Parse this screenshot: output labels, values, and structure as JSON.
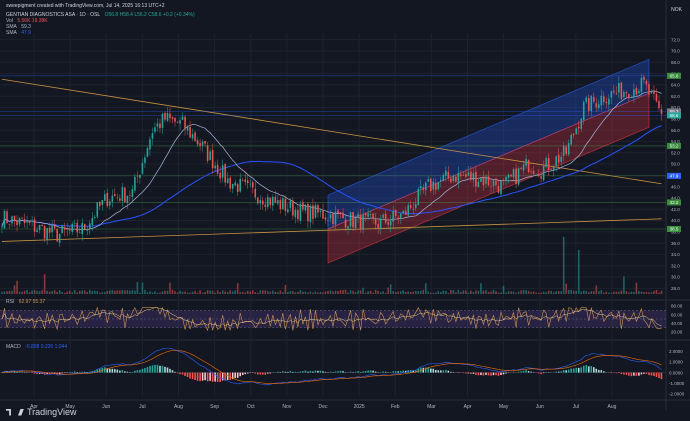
{
  "header": {
    "credit": "sweepigment created with TradingView.com, Jul 14, 2025 16:13 UTC+2",
    "symbol_line": "GENTIAN DIAGNOSTICS ASA · 1D · OSL",
    "ohlc": "O56.8 H58.4 L56.2 C58.6 +0.2 (+0.34%)",
    "vol_label": "Vol",
    "vol_values": "5.56K  19.38K",
    "sma1_label": "SMA",
    "sma1_value": "59.3",
    "sma2_label": "SMA",
    "sma2_value": "47.9",
    "currency": "NOK",
    "rsi_label": "RSI",
    "rsi_values": "62.97  55.37",
    "macd_label": "MACD",
    "macd_values": "-0.808  0.226  1.044",
    "brand": "TradingView"
  },
  "colors": {
    "background": "#131722",
    "up": "#26a69a",
    "down": "#ef5350",
    "channel_upper": "#2962ff",
    "channel_lower": "#f23645",
    "sma_fast": "#a9b7d8",
    "sma_slow": "#2952ff",
    "trendline": "#c8923f",
    "rsi_line": "#ce9455",
    "rsi_band": "#7e57c2",
    "support_line": "#4caf50"
  },
  "chart_data": {
    "type": "candlestick",
    "x_ticks": [
      "Apr",
      "May",
      "Jun",
      "Jul",
      "Aug",
      "Sep",
      "Oct",
      "Nov",
      "Dec",
      "2025",
      "Feb",
      "Mar",
      "Apr",
      "May",
      "Jun",
      "Jul",
      "Aug"
    ],
    "y_ticks": [
      28.0,
      30.0,
      32.0,
      34.0,
      36.0,
      38.0,
      40.0,
      42.0,
      44.0,
      46.0,
      48.0,
      50.0,
      52.0,
      54.0,
      56.0,
      58.0,
      60.0,
      62.0,
      64.0,
      66.0,
      68.0,
      70.0,
      72.0
    ],
    "ylim": [
      27,
      73
    ],
    "price_path": [
      [
        0,
        40.5
      ],
      [
        12,
        39
      ],
      [
        22,
        37.5
      ],
      [
        32,
        38.5
      ],
      [
        42,
        44
      ],
      [
        52,
        45
      ],
      [
        60,
        56
      ],
      [
        65,
        58
      ],
      [
        72,
        57
      ],
      [
        80,
        53
      ],
      [
        90,
        47
      ],
      [
        100,
        45
      ],
      [
        110,
        43
      ],
      [
        120,
        41.5
      ],
      [
        130,
        41
      ],
      [
        140,
        40
      ],
      [
        150,
        39.5
      ],
      [
        160,
        41
      ],
      [
        170,
        46
      ],
      [
        180,
        48
      ],
      [
        190,
        47.5
      ],
      [
        200,
        46
      ],
      [
        210,
        50
      ],
      [
        215,
        49
      ],
      [
        225,
        52
      ],
      [
        232,
        60
      ],
      [
        240,
        62
      ],
      [
        248,
        63
      ],
      [
        256,
        64
      ],
      [
        263,
        58.6
      ]
    ],
    "highlighted_levels": [
      {
        "value": 65.6,
        "label": "65.6"
      },
      {
        "value": 59.3,
        "label": "59.3"
      },
      {
        "value": 58.6,
        "label": "58.6"
      },
      {
        "value": 53.2,
        "label": "53.2"
      },
      {
        "value": 47.9,
        "label": "47.9"
      },
      {
        "value": 43.2,
        "label": "43.2"
      },
      {
        "value": 38.5,
        "label": "38.5"
      }
    ],
    "channel": {
      "start_x": 130,
      "end_x": 258,
      "upper_start": 44.5,
      "upper_end": 68.5,
      "mid_start": 38.5,
      "mid_end": 62.5,
      "lower_start": 32.5,
      "lower_end": 56.5
    },
    "trendlines": [
      {
        "from": [
          0,
          65
        ],
        "to": [
          263,
          46.5
        ]
      },
      {
        "from": [
          0,
          36.3
        ],
        "to": [
          263,
          40.3
        ]
      }
    ],
    "rsi": {
      "ylim": [
        20,
        80
      ],
      "ticks": [
        80,
        60,
        40,
        20
      ],
      "band": [
        30,
        70
      ]
    },
    "macd": {
      "ylim": [
        -2.2,
        2.4
      ],
      "ticks": [
        2.0,
        1.0,
        0.0,
        -1.0,
        -2.0
      ],
      "tick_labels": [
        "2.0000",
        "1.0000",
        "0.0000",
        "-1.0000",
        "-2.0000"
      ]
    }
  }
}
